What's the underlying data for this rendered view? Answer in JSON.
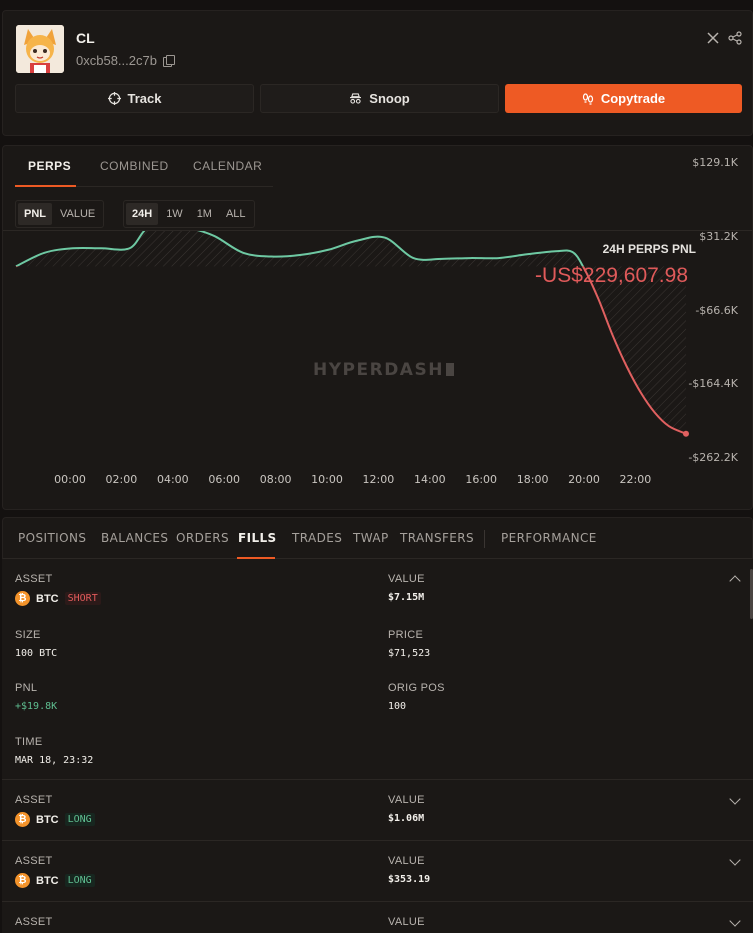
{
  "profile": {
    "name": "CL",
    "address": "0xcb58...2c7b",
    "buttons": {
      "track": "Track",
      "snoop": "Snoop",
      "copytrade": "Copytrade"
    },
    "colors": {
      "accent": "#ee5a24"
    }
  },
  "chart_tabs": [
    "PERPS",
    "COMBINED",
    "CALENDAR"
  ],
  "metric_toggle": [
    "PNL",
    "VALUE"
  ],
  "range_toggle": [
    "24H",
    "1W",
    "1M",
    "ALL"
  ],
  "chart": {
    "title": "24H PERPS PNL",
    "value": "-US$229,607.98",
    "watermark": "HYPERDASH"
  },
  "chart_data": {
    "type": "line",
    "x_ticks": [
      "00:00",
      "02:00",
      "04:00",
      "06:00",
      "08:00",
      "10:00",
      "12:00",
      "14:00",
      "16:00",
      "18:00",
      "20:00",
      "22:00"
    ],
    "y_ticks": [
      "$129.1K",
      "$31.2K",
      "-$66.6K",
      "-$164.4K",
      "-$262.2K"
    ],
    "y_tick_values": [
      129.1,
      31.2,
      -66.6,
      -164.4,
      -262.2
    ],
    "ylim": [
      -262.2,
      129.1
    ],
    "x_hours": [
      0,
      1,
      2,
      3,
      4,
      4.6,
      5.3,
      6.2,
      7,
      8,
      9,
      10,
      11,
      12,
      13,
      14,
      15,
      16,
      17,
      18,
      19,
      19.6,
      20,
      20.5,
      21,
      21.5,
      22,
      22.5,
      23,
      23.6
    ],
    "y_values": [
      -8,
      10,
      16,
      16,
      16,
      42,
      47,
      42,
      32,
      10,
      5,
      7,
      14,
      26,
      30,
      3,
      2,
      3,
      3,
      8,
      12,
      11,
      -10,
      -50,
      -98,
      -140,
      -175,
      -202,
      -220,
      -230
    ],
    "line_color_positive": "#6ec9a3",
    "line_color_negative": "#e06060",
    "zero_value": -8
  },
  "bottom_tabs": [
    "POSITIONS",
    "BALANCES",
    "ORDERS",
    "FILLS",
    "TRADES",
    "TWAP",
    "TRANSFERS",
    "PERFORMANCE"
  ],
  "fills": {
    "labels": {
      "asset": "ASSET",
      "value": "VALUE",
      "size": "SIZE",
      "price": "PRICE",
      "pnl": "PNL",
      "orig_pos": "ORIG POS",
      "time": "TIME"
    },
    "expanded": {
      "asset": "BTC",
      "side": "SHORT",
      "value": "$7.15M",
      "size": "100 BTC",
      "price": "$71,523",
      "pnl": "+$19.8K",
      "orig_pos": "100",
      "time": "MAR 18, 23:32"
    },
    "rows": [
      {
        "asset": "BTC",
        "side": "LONG",
        "value": "$1.06M"
      },
      {
        "asset": "BTC",
        "side": "LONG",
        "value": "$353.19"
      }
    ]
  }
}
